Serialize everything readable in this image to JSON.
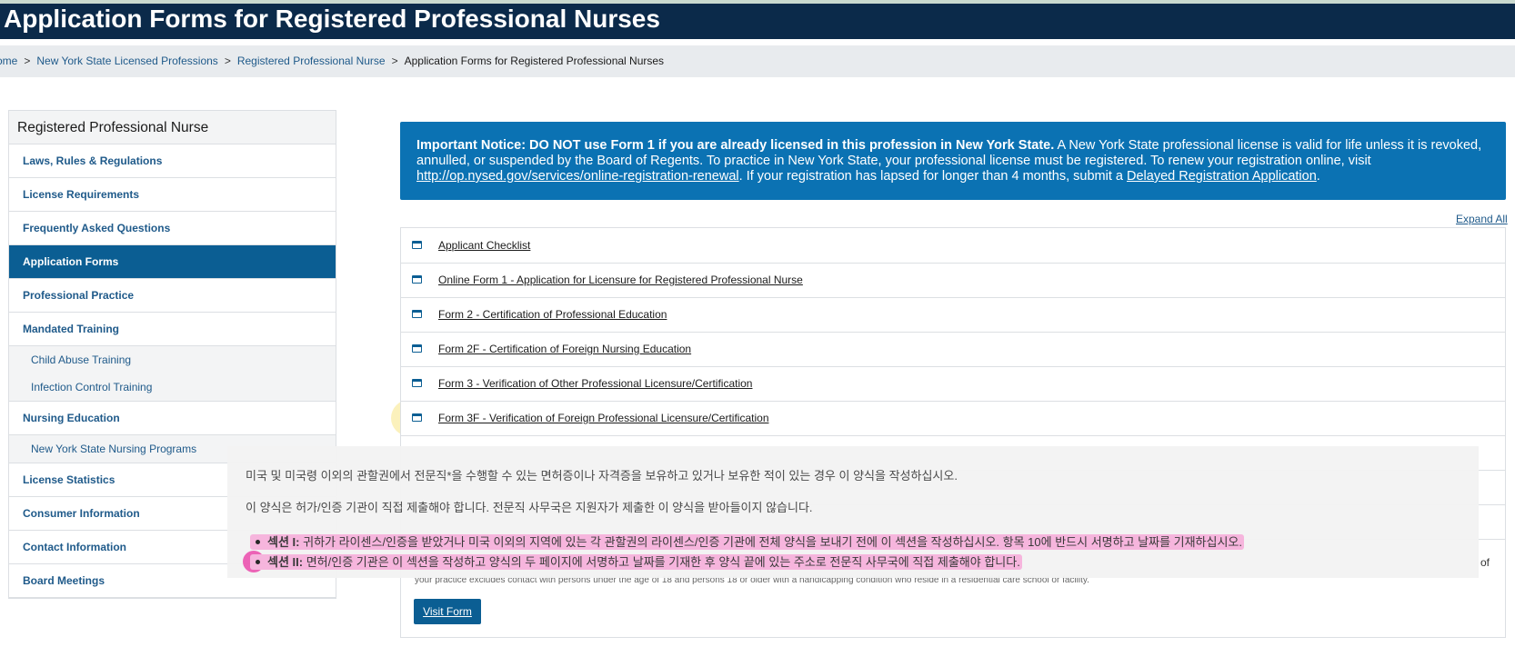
{
  "header": {
    "title": "Application Forms for Registered Professional Nurses"
  },
  "breadcrumb": {
    "items": [
      "ome",
      "New York State Licensed Professions",
      "Registered Professional Nurse"
    ],
    "current": "Application Forms for Registered Professional Nurses",
    "separator": ">"
  },
  "sidebar": {
    "heading": "Registered Professional Nurse",
    "items": [
      {
        "label": "Laws, Rules & Regulations"
      },
      {
        "label": "License Requirements"
      },
      {
        "label": "Frequently Asked Questions"
      },
      {
        "label": "Application Forms",
        "active": true
      },
      {
        "label": "Professional Practice"
      },
      {
        "label": "Mandated Training"
      },
      {
        "label": "Child Abuse Training",
        "sub": true
      },
      {
        "label": "Infection Control Training",
        "sub": true
      },
      {
        "label": "Nursing Education"
      },
      {
        "label": "New York State Nursing Programs",
        "sub": true
      },
      {
        "label": "License Statistics"
      },
      {
        "label": "Consumer Information"
      },
      {
        "label": "Contact Information"
      },
      {
        "label": "Board Meetings"
      }
    ]
  },
  "notice": {
    "bold": "Important Notice: DO NOT use Form 1 if you are already licensed in this profession in New York State.",
    "text1": " A New York State professional license is valid for life unless it is revoked, annulled, or suspended by the Board of Regents. To practice in New York State, your professional license must be registered. To renew your registration online, visit ",
    "link1": "http://op.nysed.gov/services/online-registration-renewal",
    "text2": ". If your registration has lapsed for longer than 4 months, submit a ",
    "link2": "Delayed Registration Application",
    "text3": "."
  },
  "expand_all": "Expand All",
  "forms": [
    "Applicant Checklist",
    "Online Form 1 - Application for Licensure for Registered Professional Nurse",
    "Form 2 - Certification of Professional Education",
    "Form 2F - Certification of Foreign Nursing Education",
    "Form 3 - Verification of Other Professional Licensure/Certification",
    "Form 3F - Verification of Foreign Professional Licensure/Certification"
  ],
  "behind_text": "your practice excludes contact with persons under the age of 18 and persons 18 or older with a handicapping condition who reside in a residential care school or facility.",
  "of_text": "of",
  "visit_button": "Visit Form",
  "overlay": {
    "line1": "미국 및 미국령 이외의 관할권에서 전문직*을 수행할 수 있는 면허증이나 자격증을 보유하고 있거나 보유한 적이 있는 경우 이 양식을 작성하십시오.",
    "line2": "이 양식은 허가/인증 기관이 직접 제출해야 합니다. 전문직 사무국은 지원자가 제출한 이 양식을 받아들이지 않습니다.",
    "bullet1_label": "섹션 I:",
    "bullet1_text": "귀하가 라이센스/인증을 받았거나 미국 이외의 지역에 있는 각 관할권의 라이센스/인증 기관에 전체 양식을 보내기 전에 이 섹션을 작성하십시오. 항목 10에 반드시 서명하고 날짜를 기재하십시오.",
    "bullet2_label": "섹션 II:",
    "bullet2_text": "면허/인증 기관은 이 섹션을 작성하고 양식의 두 페이지에 서명하고 날짜를 기재한 후 양식 끝에 있는 주소로 전문직 사무국에 직접 제출해야 합니다."
  },
  "colors": {
    "header_bg": "#0b2a4a",
    "notice_bg": "#0b72b3",
    "active_nav": "#0b5e93",
    "highlight_yellow": "#fbf0b5",
    "highlight_pink": "#f6b3dc"
  }
}
